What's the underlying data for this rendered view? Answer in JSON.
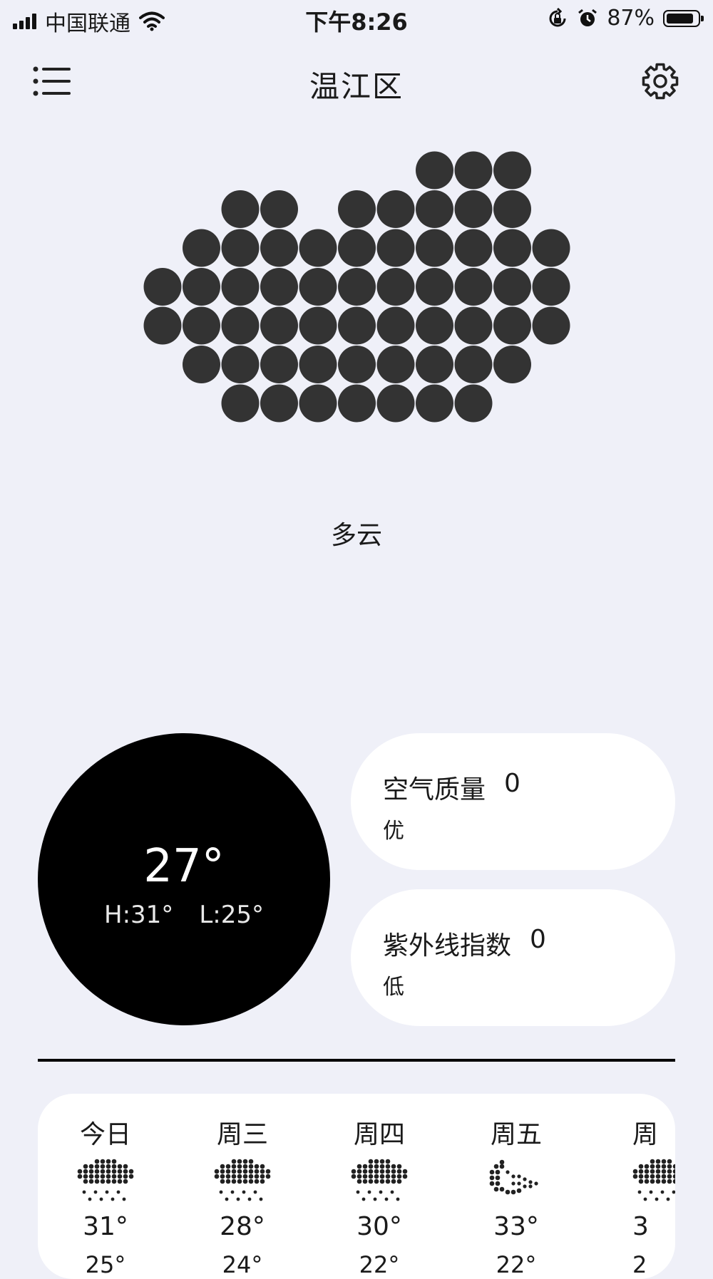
{
  "status_bar": {
    "carrier": "中国联通",
    "time": "下午8:26",
    "battery_text": "87%",
    "battery_level": 0.87,
    "icons": [
      "signal-icon",
      "wifi-icon",
      "orientation-lock-icon",
      "alarm-icon",
      "battery-icon"
    ]
  },
  "header": {
    "title": "温江区",
    "menu_icon": "list-menu-icon",
    "settings_icon": "gear-icon"
  },
  "current": {
    "condition": "多云",
    "hero_icon": "cloud-icon",
    "temperature": "27°",
    "high": "H:31°",
    "low": "L:25°"
  },
  "air_quality": {
    "label": "空气质量",
    "value": "0",
    "level": "优"
  },
  "uv_index": {
    "label": "紫外线指数",
    "value": "0",
    "level": "低"
  },
  "forecast": [
    {
      "day": "今日",
      "icon": "cloud-rain-icon",
      "high": "31°",
      "low": "25°"
    },
    {
      "day": "周三",
      "icon": "cloud-rain-icon",
      "high": "28°",
      "low": "24°"
    },
    {
      "day": "周四",
      "icon": "cloud-rain-icon",
      "high": "30°",
      "low": "22°"
    },
    {
      "day": "周五",
      "icon": "moon-cloud-icon",
      "high": "33°",
      "low": "22°"
    },
    {
      "day": "周",
      "icon": "cloud-rain-icon",
      "high": "3",
      "low": "2"
    }
  ],
  "colors": {
    "background": "#eff0f8",
    "card": "#ffffff",
    "dark": "#000000",
    "dot": "#333333"
  }
}
